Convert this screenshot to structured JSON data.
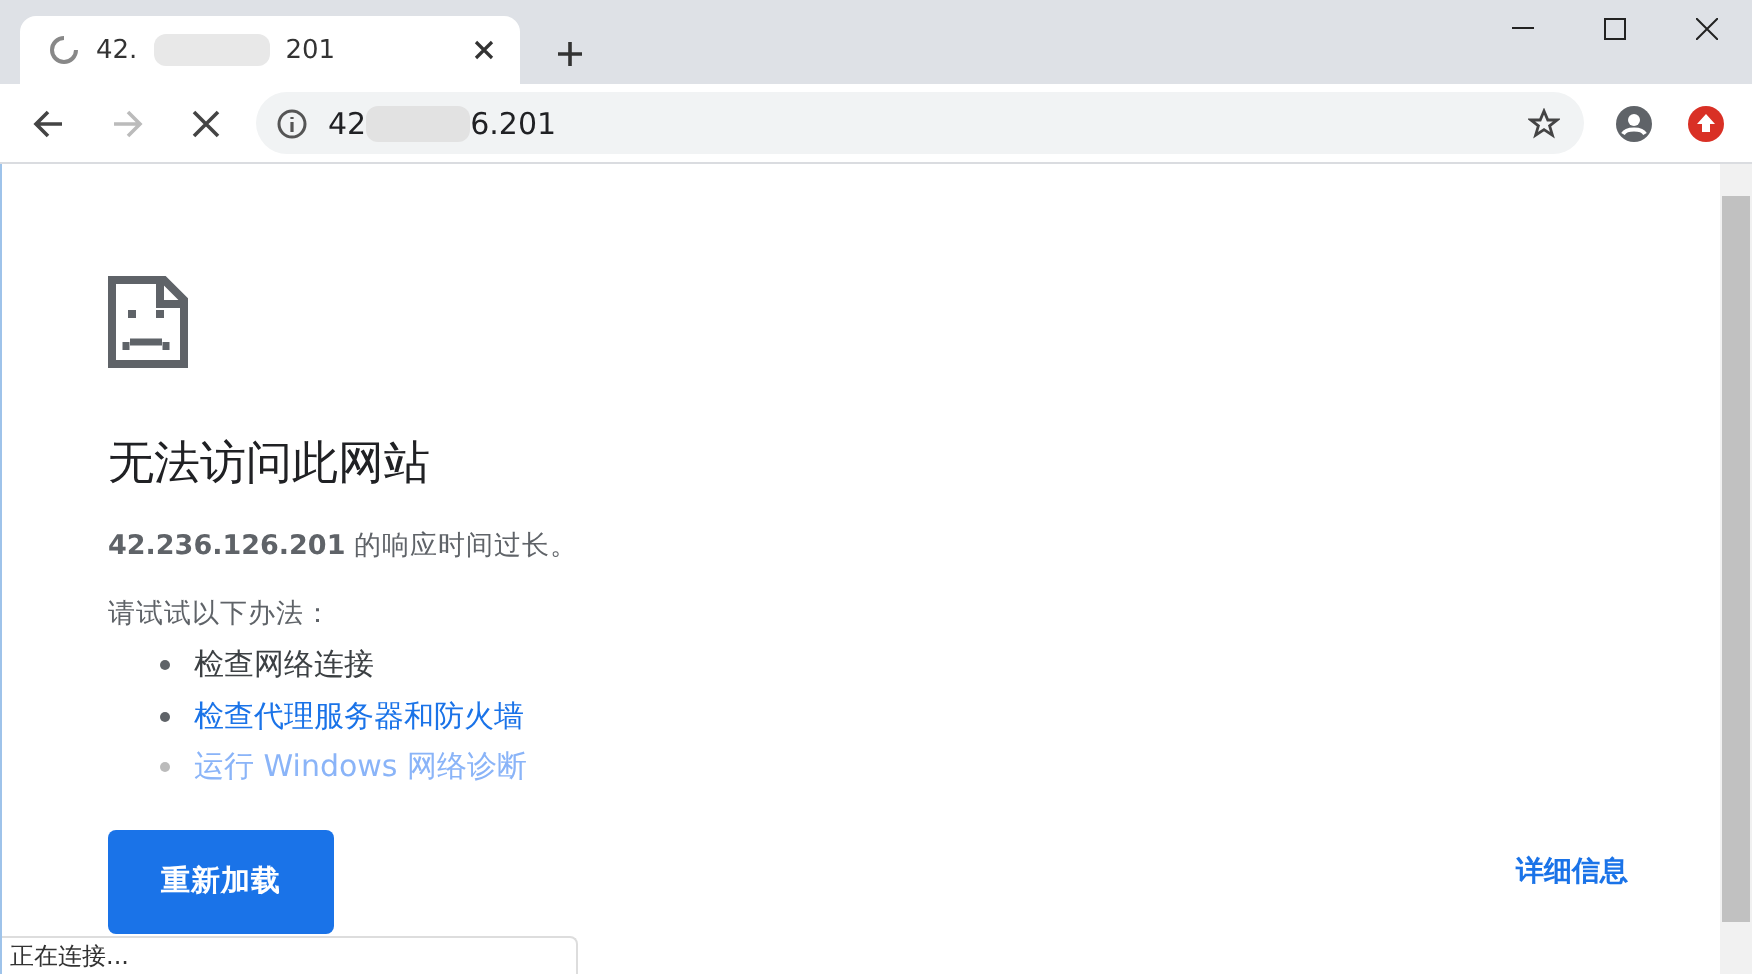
{
  "tab": {
    "title_start": "42.",
    "title_end": "201",
    "loading": true
  },
  "address_bar": {
    "url_start": "42",
    "url_end": "6.201"
  },
  "error": {
    "heading": "无法访问此网站",
    "message": "**42.236.126.201** 的响应时间过长。",
    "suggestion_intro": "请试试以下办法：",
    "suggestions": [
      {
        "text": "检查网络连接",
        "kind": "plain"
      },
      {
        "text": "检查代理服务器和防火墙",
        "kind": "link"
      },
      {
        "text": "运行 Windows 网络诊断",
        "kind": "muted_link"
      }
    ],
    "reload_button": "重新加载",
    "details_button": "详细信息"
  },
  "status_bar": "正在连接..."
}
